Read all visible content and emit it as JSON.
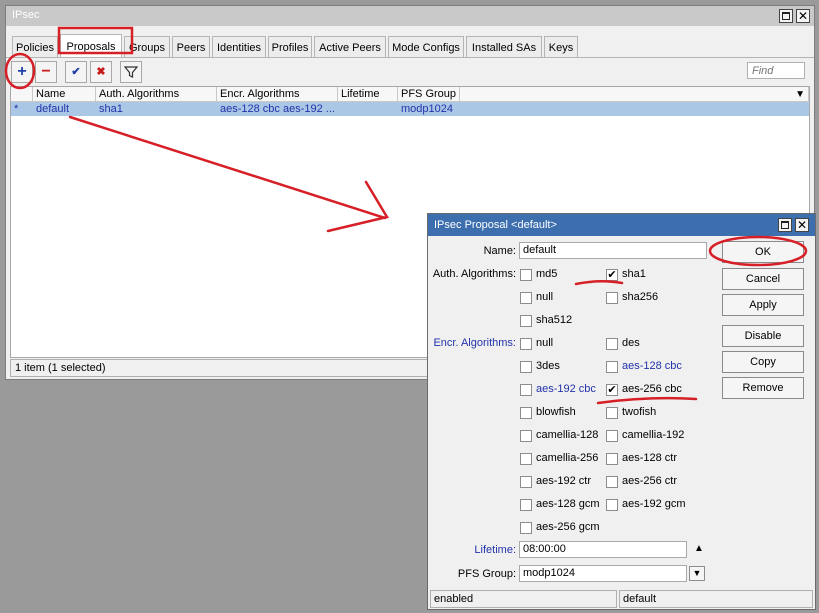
{
  "main_window": {
    "title": "IPsec",
    "tabs": [
      "Policies",
      "Proposals",
      "Groups",
      "Peers",
      "Identities",
      "Profiles",
      "Active Peers",
      "Mode Configs",
      "Installed SAs",
      "Keys"
    ],
    "toolbar": {
      "add": "+",
      "remove": "−",
      "enable": "✔",
      "disable": "✖",
      "filter": "filter-icon"
    },
    "find_placeholder": "Find",
    "columns": [
      "Name",
      "Auth. Algorithms",
      "Encr. Algorithms",
      "Lifetime",
      "PFS Group"
    ],
    "rows": [
      {
        "flag": "*",
        "name": "default",
        "auth": "sha1",
        "encr": "aes-128 cbc aes-192 ...",
        "lifetime": "",
        "pfs": "modp1024"
      }
    ],
    "status": "1 item (1 selected)"
  },
  "dialog": {
    "title": "IPsec Proposal <default>",
    "name_label": "Name:",
    "name_value": "default",
    "auth_label": "Auth. Algorithms:",
    "auth_options": [
      {
        "label": "md5",
        "checked": false
      },
      {
        "label": "sha1",
        "checked": true
      },
      {
        "label": "null",
        "checked": false
      },
      {
        "label": "sha256",
        "checked": false
      },
      {
        "label": "sha512",
        "checked": false
      }
    ],
    "encr_label": "Encr. Algorithms:",
    "encr_options": [
      {
        "label": "null",
        "checked": false
      },
      {
        "label": "des",
        "checked": false
      },
      {
        "label": "3des",
        "checked": false
      },
      {
        "label": "aes-128 cbc",
        "checked": false
      },
      {
        "label": "aes-192 cbc",
        "checked": false
      },
      {
        "label": "aes-256 cbc",
        "checked": true
      },
      {
        "label": "blowfish",
        "checked": false
      },
      {
        "label": "twofish",
        "checked": false
      },
      {
        "label": "camellia-128",
        "checked": false
      },
      {
        "label": "camellia-192",
        "checked": false
      },
      {
        "label": "camellia-256",
        "checked": false
      },
      {
        "label": "aes-128 ctr",
        "checked": false
      },
      {
        "label": "aes-192 ctr",
        "checked": false
      },
      {
        "label": "aes-256 ctr",
        "checked": false
      },
      {
        "label": "aes-128 gcm",
        "checked": false
      },
      {
        "label": "aes-192 gcm",
        "checked": false
      },
      {
        "label": "aes-256 gcm",
        "checked": false
      }
    ],
    "lifetime_label": "Lifetime:",
    "lifetime_value": "08:00:00",
    "pfs_label": "PFS Group:",
    "pfs_value": "modp1024",
    "buttons": [
      "OK",
      "Cancel",
      "Apply",
      "Disable",
      "Copy",
      "Remove"
    ],
    "status_left": "enabled",
    "status_right": "default"
  },
  "colors": {
    "annotation": "#d61f26",
    "selection": "#aac7e6",
    "dialog_title": "#3d6fae",
    "link_blue": "#2233aa"
  }
}
